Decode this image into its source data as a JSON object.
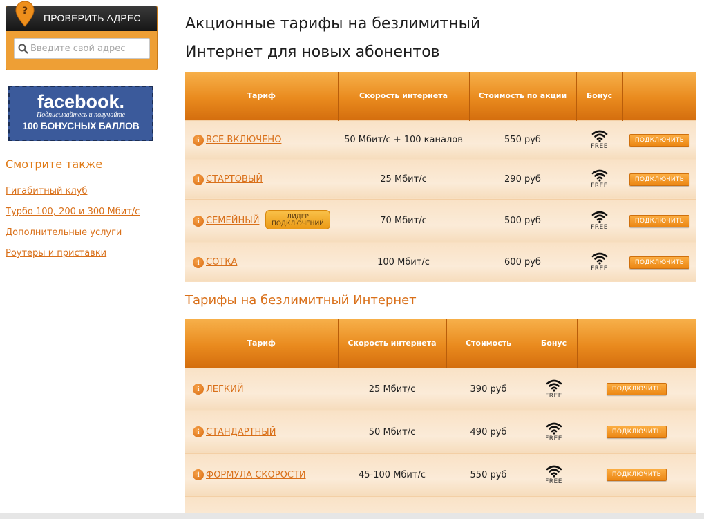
{
  "sidebar": {
    "check_address": {
      "title": "ПРОВЕРИТЬ АДРЕС",
      "pin_glyph": "?",
      "input_placeholder": "Введите свой адрес"
    },
    "facebook_banner": {
      "logo": "facebook.",
      "subtitle": "Подписывайтесь и получайте",
      "bonus": "100 БОНУСНЫХ БАЛЛОВ"
    },
    "see_also": {
      "title": "Смотрите также",
      "links": [
        "Гигабитный клуб",
        "Турбо 100, 200 и 300 Мбит/с",
        "Дополнительные услуги",
        "Роутеры и приставки"
      ]
    }
  },
  "main": {
    "title": "Акционные тарифы на безлимитный Интернет для новых абонентов",
    "promo_table": {
      "headers": [
        "Тариф",
        "Скорость интернета",
        "Стоимость по акции",
        "Бонус",
        ""
      ],
      "rows": [
        {
          "name": "ВСЕ ВКЛЮЧЕНО",
          "speed": "50 Мбит/с + 100 каналов",
          "price": "550 руб",
          "bonus": "FREE",
          "button": "ПОДКЛЮЧИТЬ"
        },
        {
          "name": "СТАРТОВЫЙ",
          "speed": "25 Мбит/с",
          "price": "290 руб",
          "bonus": "FREE",
          "button": "ПОДКЛЮЧИТЬ"
        },
        {
          "name": "СЕМЕЙНЫЙ",
          "badge": "ЛИДЕР ПОДКЛЮЧЕНИЙ",
          "speed": "70 Мбит/с",
          "price": "500 руб",
          "bonus": "FREE",
          "button": "ПОДКЛЮЧИТЬ"
        },
        {
          "name": "СОТКА",
          "speed": "100 Мбит/с",
          "price": "600 руб",
          "bonus": "FREE",
          "button": "ПОДКЛЮЧИТЬ"
        }
      ]
    },
    "section_title": "Тарифы на безлимитный Интернет",
    "standard_table": {
      "headers": [
        "Тариф",
        "Скорость интернета",
        "Стоимость",
        "Бонус",
        ""
      ],
      "rows": [
        {
          "name": "ЛЕГКИЙ",
          "speed": "25 Мбит/с",
          "price": "390 руб",
          "bonus": "FREE",
          "button": "ПОДКЛЮЧИТЬ"
        },
        {
          "name": "СТАНДАРТНЫЙ",
          "speed": "50 Мбит/с",
          "price": "490 руб",
          "bonus": "FREE",
          "button": "ПОДКЛЮЧИТЬ"
        },
        {
          "name": "ФОРМУЛА СКОРОСТИ",
          "speed": "45-100 Мбит/с",
          "price": "550 руб",
          "bonus": "FREE",
          "button": "ПОДКЛЮЧИТЬ"
        },
        {
          "name": "",
          "speed": "",
          "price": "",
          "bonus": "",
          "button": ""
        }
      ]
    },
    "info_icon_glyph": "i"
  },
  "colors": {
    "accent": "#e98a1e",
    "link": "#d9701a",
    "header_dark": "#1a1a1a",
    "facebook_blue": "#3b5a9b",
    "row_bg": "#fbebd8"
  },
  "icons": {
    "search": "search-icon",
    "pin": "map-pin-icon",
    "info": "info-icon",
    "wifi": "wifi-icon"
  }
}
